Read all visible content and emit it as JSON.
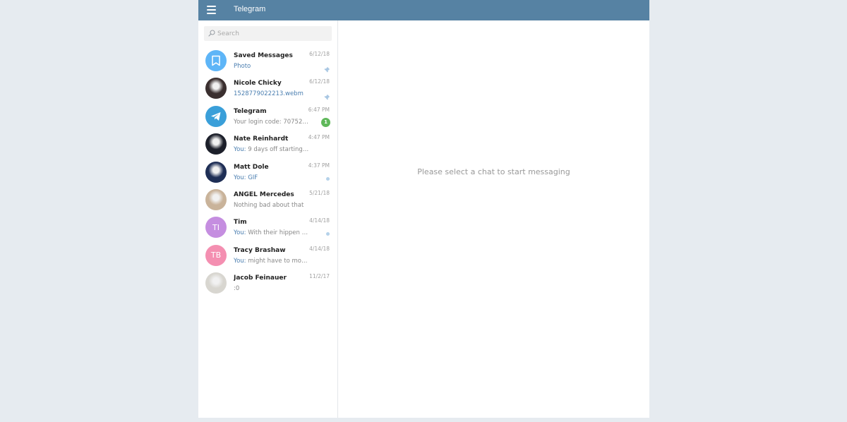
{
  "header": {
    "title": "Telegram",
    "menu_icon": "hamburger-menu-icon",
    "background_color": "#5682a3"
  },
  "search": {
    "placeholder": "Search",
    "icon": "search-icon"
  },
  "chats": [
    {
      "name": "Saved Messages",
      "date": "6/12/18",
      "preview": "Photo",
      "preview_style": "media",
      "pinned": true,
      "avatar": "bookmark-icon",
      "avatar_color": "#5eb5f7"
    },
    {
      "name": "Nicole Chicky",
      "date": "6/12/18",
      "preview": "1528779022213.webm",
      "preview_style": "media",
      "pinned": true,
      "avatar": "photo",
      "avatar_color": "#3a2f2f"
    },
    {
      "name": "Telegram",
      "date": "6:47 PM",
      "preview": "Your login code: 70752 ...",
      "preview_style": "text",
      "unread": "1",
      "avatar": "telegram-logo-icon",
      "avatar_color": "#3a9fd9"
    },
    {
      "name": "Nate Reinhardt",
      "date": "4:47 PM",
      "you": "You:",
      "preview": "9 days off starting ...",
      "avatar": "photo",
      "avatar_color": "#1c1f2a"
    },
    {
      "name": "Matt Dole",
      "date": "4:37 PM",
      "you": "You:",
      "preview": "GIF",
      "preview_style": "media",
      "unread_dot": true,
      "avatar": "photo",
      "avatar_color": "#1e2e55"
    },
    {
      "name": "ANGEL Mercedes",
      "date": "5/21/18",
      "preview": "Nothing bad about that",
      "preview_style": "text",
      "avatar": "photo",
      "avatar_color": "#c9b39a"
    },
    {
      "name": "Tim",
      "date": "4/14/18",
      "you": "You:",
      "preview": "With their hippen a...",
      "unread_dot": true,
      "avatar_initials": "TI",
      "avatar_color": "#c58ee0"
    },
    {
      "name": "Tracy Brashaw",
      "date": "4/14/18",
      "you": "You:",
      "preview": "might have to mov...",
      "avatar_initials": "TB",
      "avatar_color": "#f48fb1"
    },
    {
      "name": "Jacob Feinauer",
      "date": "11/2/17",
      "preview": ":0",
      "preview_style": "text",
      "avatar": "photo",
      "avatar_color": "#d8d6d0"
    }
  ],
  "empty_state": {
    "message": "Please select a chat to start messaging"
  }
}
